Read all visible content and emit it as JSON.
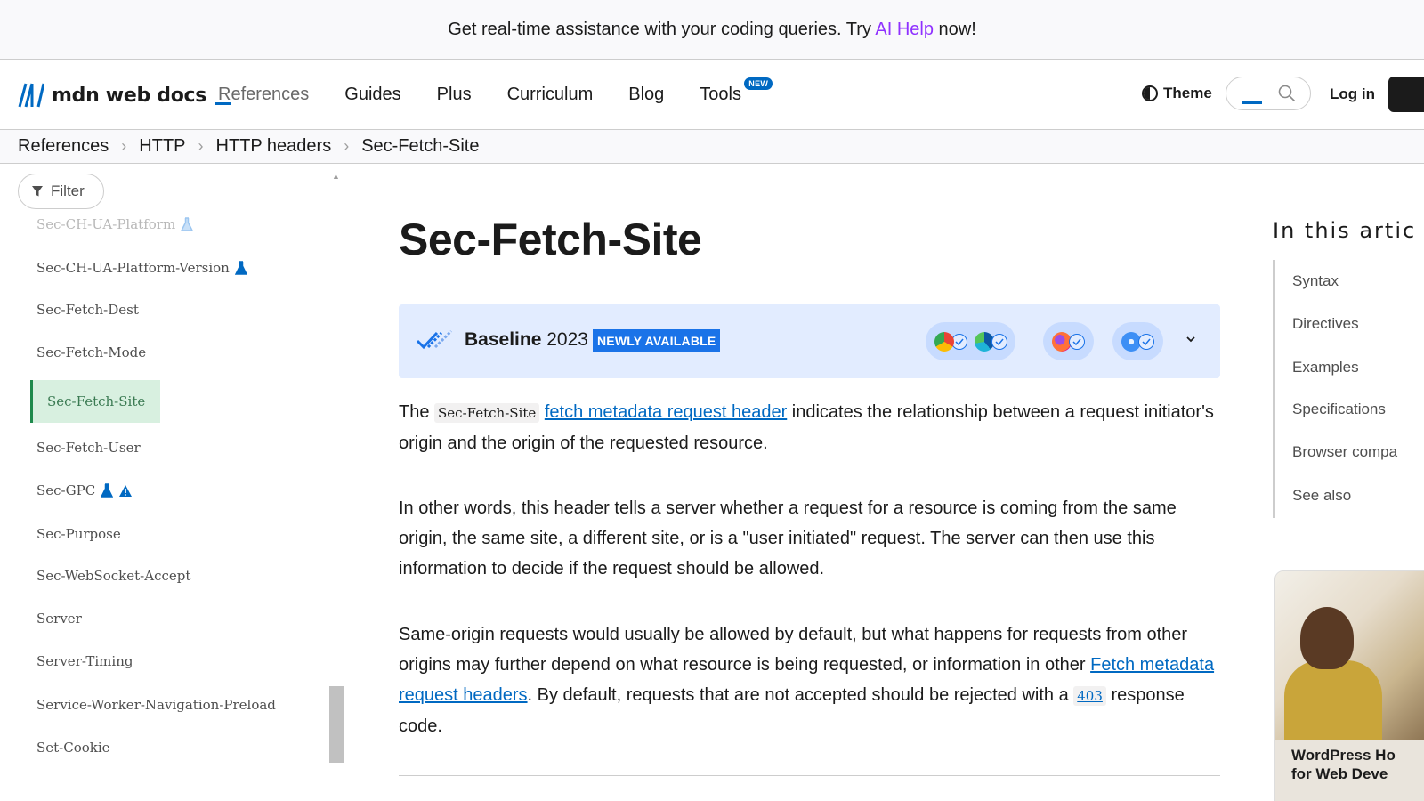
{
  "banner": {
    "text_before": "Get real-time assistance with your coding queries. Try ",
    "link": "AI Help",
    "text_after": " now!"
  },
  "header": {
    "logo_text": "mdn web docs",
    "nav": [
      {
        "label": "References"
      },
      {
        "label": "Guides"
      },
      {
        "label": "Plus"
      },
      {
        "label": "Curriculum"
      },
      {
        "label": "Blog"
      },
      {
        "label": "Tools",
        "badge": "NEW"
      }
    ],
    "theme_label": "Theme",
    "login_label": "Log in"
  },
  "breadcrumb": [
    "References",
    "HTTP",
    "HTTP headers",
    "Sec-Fetch-Site"
  ],
  "sidebar": {
    "filter_label": "Filter",
    "items": [
      {
        "label": "Sec-CH-UA-Platform"
      },
      {
        "label": "Sec-CH-UA-Platform-Version"
      },
      {
        "label": "Sec-Fetch-Dest"
      },
      {
        "label": "Sec-Fetch-Mode"
      },
      {
        "label": "Sec-Fetch-Site"
      },
      {
        "label": "Sec-Fetch-User"
      },
      {
        "label": "Sec-GPC"
      },
      {
        "label": "Sec-Purpose"
      },
      {
        "label": "Sec-WebSocket-Accept"
      },
      {
        "label": "Server"
      },
      {
        "label": "Server-Timing"
      },
      {
        "label": "Service-Worker-Navigation-Preload"
      },
      {
        "label": "Set-Cookie"
      }
    ]
  },
  "main": {
    "title": "Sec-Fetch-Site",
    "baseline": {
      "label_bold": "Baseline",
      "year": "2023",
      "status": "NEWLY AVAILABLE"
    },
    "p1": {
      "t1": "The ",
      "code": "Sec-Fetch-Site",
      "t2": " ",
      "link": "fetch metadata request header",
      "t3": " indicates the relationship between a request initiator's origin and the origin of the requested resource."
    },
    "p2": "In other words, this header tells a server whether a request for a resource is coming from the same origin, the same site, a different site, or is a \"user initiated\" request. The server can then use this information to decide if the request should be allowed.",
    "p3": {
      "t1": "Same-origin requests would usually be allowed by default, but what happens for requests from other origins may further depend on what resource is being requested, or information in other ",
      "link": "Fetch metadata request headers",
      "t2": ". By default, requests that are not accepted should be rejected with a ",
      "code": "403",
      "t3": " response code."
    }
  },
  "toc": {
    "title": "In this artic",
    "items": [
      "Syntax",
      "Directives",
      "Examples",
      "Specifications",
      "Browser compa",
      "See also"
    ]
  },
  "ad": {
    "line1": "WordPress Ho",
    "line2": "for Web Deve"
  },
  "colors": {
    "accent": "#0069c2",
    "ai_help": "#8f31ff",
    "baseline_bg": "#e2ecff",
    "active_item_bg": "#d8f0e0"
  }
}
